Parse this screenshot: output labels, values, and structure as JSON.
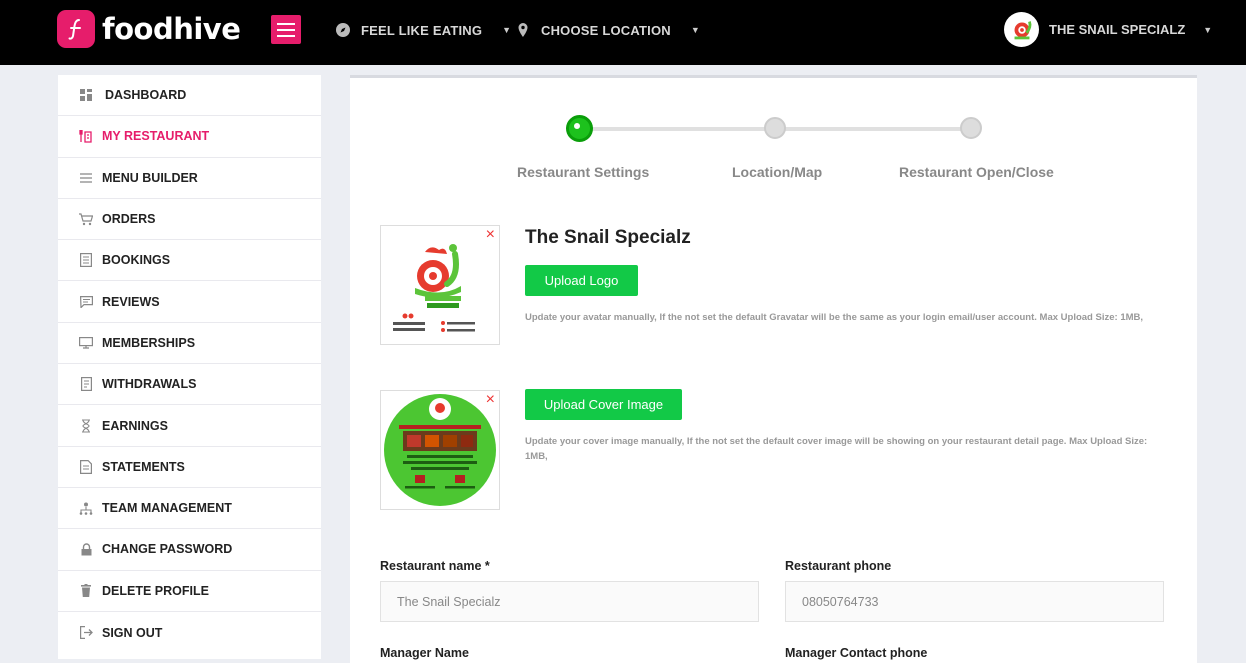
{
  "brand": {
    "name": "foodhive",
    "accent": "#e61d6b"
  },
  "topnav": {
    "feel_like_eating": "FEEL LIKE EATING",
    "choose_location": "CHOOSE LOCATION",
    "user_name": "THE SNAIL SPECIALZ"
  },
  "sidebar": {
    "items": [
      {
        "label": "DASHBOARD",
        "icon": "dashboard-icon"
      },
      {
        "label": "MY RESTAURANT",
        "icon": "restaurant-icon",
        "active": true
      },
      {
        "label": "MENU BUILDER",
        "icon": "menu-icon"
      },
      {
        "label": "ORDERS",
        "icon": "cart-icon"
      },
      {
        "label": "BOOKINGS",
        "icon": "bookings-icon"
      },
      {
        "label": "REVIEWS",
        "icon": "reviews-icon"
      },
      {
        "label": "MEMBERSHIPS",
        "icon": "monitor-icon"
      },
      {
        "label": "WITHDRAWALS",
        "icon": "withdrawals-icon"
      },
      {
        "label": "EARNINGS",
        "icon": "hourglass-icon"
      },
      {
        "label": "STATEMENTS",
        "icon": "statements-icon"
      },
      {
        "label": "TEAM MANAGEMENT",
        "icon": "team-icon"
      },
      {
        "label": "CHANGE PASSWORD",
        "icon": "lock-icon"
      },
      {
        "label": "DELETE PROFILE",
        "icon": "trash-icon"
      },
      {
        "label": "SIGN OUT",
        "icon": "signout-icon"
      }
    ]
  },
  "stepper": {
    "steps": [
      "Restaurant Settings",
      "Location/Map",
      "Restaurant Open/Close"
    ],
    "active_index": 0
  },
  "restaurant": {
    "title": "The Snail Specialz",
    "upload_logo": "Upload Logo",
    "logo_hint": "Update your avatar manually, If the not set the default Gravatar will be the same as your login email/user account. Max Upload Size: 1MB,",
    "upload_cover": "Upload Cover Image",
    "cover_hint": "Update your cover image manually, If the not set the default cover image will be showing on your restaurant detail page. Max Upload Size: 1MB,"
  },
  "form": {
    "restaurant_name_label": "Restaurant name *",
    "restaurant_name_value": "The Snail Specialz",
    "restaurant_phone_label": "Restaurant phone",
    "restaurant_phone_value": "08050764733",
    "manager_name_label": "Manager Name",
    "manager_phone_label": "Manager Contact phone"
  }
}
